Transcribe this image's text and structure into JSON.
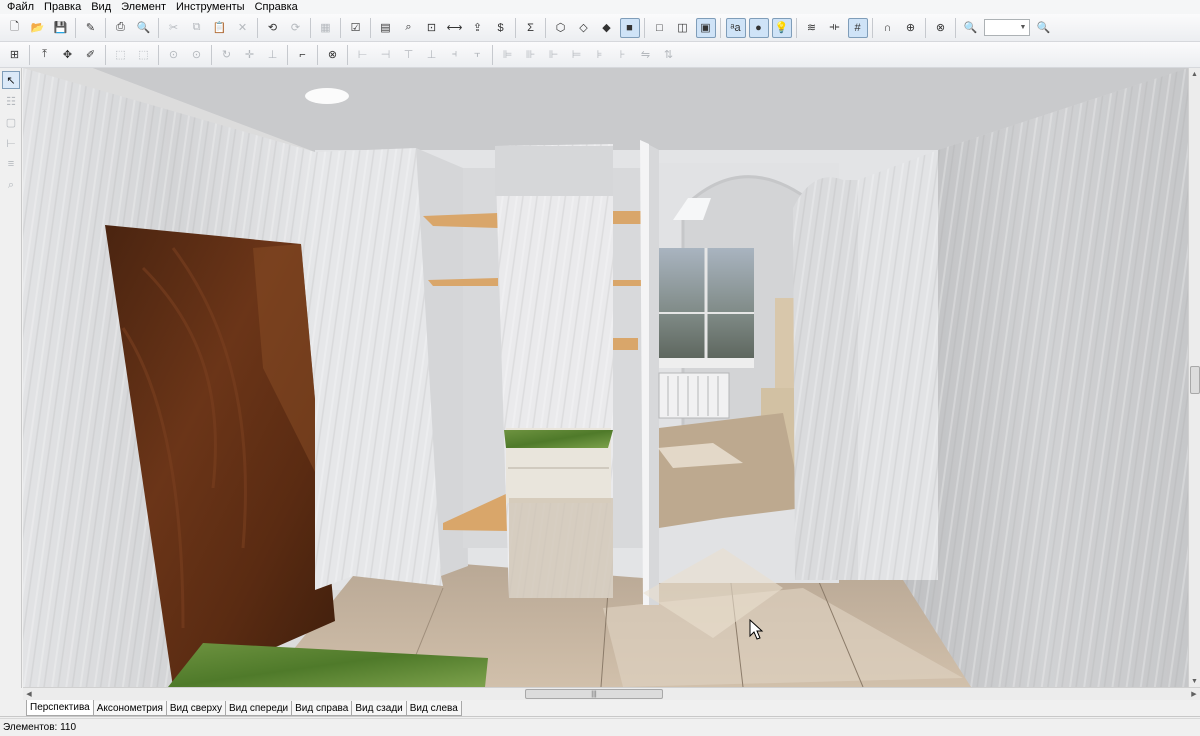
{
  "menu": [
    "Файл",
    "Правка",
    "Вид",
    "Элемент",
    "Инструменты",
    "Справка"
  ],
  "toolbar1": [
    {
      "name": "new-file-icon",
      "glyph": "🗋"
    },
    {
      "name": "open-folder-icon",
      "glyph": "📂"
    },
    {
      "name": "save-icon",
      "glyph": "💾"
    },
    {
      "sep": true
    },
    {
      "name": "properties-icon",
      "glyph": "✎"
    },
    {
      "sep": true
    },
    {
      "name": "print-icon",
      "glyph": "⎙"
    },
    {
      "name": "print-preview-icon",
      "glyph": "🔍"
    },
    {
      "sep": true
    },
    {
      "name": "cut-icon",
      "glyph": "✂",
      "dim": true
    },
    {
      "name": "copy-icon",
      "glyph": "⧉",
      "dim": true
    },
    {
      "name": "paste-icon",
      "glyph": "📋",
      "dim": true
    },
    {
      "name": "delete-icon",
      "glyph": "✕",
      "dim": true
    },
    {
      "sep": true
    },
    {
      "name": "undo-icon",
      "glyph": "⟲"
    },
    {
      "name": "redo-icon",
      "glyph": "⟳",
      "dim": true
    },
    {
      "sep": true
    },
    {
      "name": "group-icon",
      "glyph": "▦",
      "dim": true
    },
    {
      "sep": true
    },
    {
      "name": "checklist-icon",
      "glyph": "☑"
    },
    {
      "sep": true
    },
    {
      "name": "view-plan-icon",
      "glyph": "▤"
    },
    {
      "name": "view-zoom-icon",
      "glyph": "⌕"
    },
    {
      "name": "view-fit-icon",
      "glyph": "⊡"
    },
    {
      "name": "view-width-icon",
      "glyph": "⟷"
    },
    {
      "name": "export-icon",
      "glyph": "⇪"
    },
    {
      "name": "cost-icon",
      "glyph": "$"
    },
    {
      "sep": true
    },
    {
      "name": "sum-icon",
      "glyph": "Σ"
    },
    {
      "sep": true
    },
    {
      "name": "wireframe-cube-icon",
      "glyph": "⬡"
    },
    {
      "name": "outline-cube-icon",
      "glyph": "◇"
    },
    {
      "name": "shaded-cube-icon",
      "glyph": "◆"
    },
    {
      "name": "textured-cube-icon",
      "glyph": "■",
      "active": true
    },
    {
      "sep": true
    },
    {
      "name": "box-front-icon",
      "glyph": "□"
    },
    {
      "name": "box-side-icon",
      "glyph": "◫"
    },
    {
      "name": "box-filled-icon",
      "glyph": "▣",
      "active": true
    },
    {
      "sep": true
    },
    {
      "name": "antialias-icon",
      "glyph": "ᵃa",
      "active": true
    },
    {
      "name": "shadow-sphere-icon",
      "glyph": "●",
      "active": true
    },
    {
      "name": "light-bulb-icon",
      "glyph": "💡",
      "active": true
    },
    {
      "sep": true
    },
    {
      "name": "snap-icon",
      "glyph": "≋"
    },
    {
      "name": "dimension-icon",
      "glyph": "⟛"
    },
    {
      "name": "grid-icon",
      "glyph": "#",
      "active": true
    },
    {
      "sep": true
    },
    {
      "name": "magnet-icon",
      "glyph": "∩"
    },
    {
      "name": "target-icon",
      "glyph": "⊕"
    },
    {
      "sep": true
    },
    {
      "name": "lifebuoy-icon",
      "glyph": "⊗"
    },
    {
      "sep": true
    },
    {
      "name": "zoom-out-icon",
      "glyph": "🔍",
      "dim": true
    },
    {
      "zoom": true
    },
    {
      "name": "zoom-in-icon",
      "glyph": "🔍",
      "dim": true
    }
  ],
  "toolbar2": [
    {
      "name": "select-grid-icon",
      "glyph": "⊞"
    },
    {
      "sep": true
    },
    {
      "name": "move-up-icon",
      "glyph": "⤒"
    },
    {
      "name": "move-icon",
      "glyph": "✥"
    },
    {
      "name": "edit-point-icon",
      "glyph": "✐"
    },
    {
      "sep": true
    },
    {
      "name": "frame-select-icon",
      "glyph": "⬚",
      "dim": true
    },
    {
      "name": "frame-move-icon",
      "glyph": "⬚",
      "dim": true
    },
    {
      "sep": true
    },
    {
      "name": "pivot-icon",
      "glyph": "⊙",
      "dim": true
    },
    {
      "name": "pivot-move-icon",
      "glyph": "⊙",
      "dim": true
    },
    {
      "sep": true
    },
    {
      "name": "rotate-icon",
      "glyph": "↻",
      "dim": true
    },
    {
      "name": "transform-icon",
      "glyph": "✛",
      "dim": true
    },
    {
      "name": "align-base-icon",
      "glyph": "⊥",
      "dim": true
    },
    {
      "sep": true
    },
    {
      "name": "paint-roller-icon",
      "glyph": "⌐"
    },
    {
      "sep": true
    },
    {
      "name": "target2-icon",
      "glyph": "⊗"
    },
    {
      "sep": true
    },
    {
      "name": "align-left-icon",
      "glyph": "⊢",
      "dim": true
    },
    {
      "name": "align-hcenter-icon",
      "glyph": "⊣",
      "dim": true
    },
    {
      "name": "align-top-icon",
      "glyph": "⊤",
      "dim": true
    },
    {
      "name": "align-vcenter-icon",
      "glyph": "⊥",
      "dim": true
    },
    {
      "name": "align-right-icon",
      "glyph": "⫞",
      "dim": true
    },
    {
      "name": "align-bottom-icon",
      "glyph": "⫟",
      "dim": true
    },
    {
      "sep": true
    },
    {
      "name": "distribute-left-icon",
      "glyph": "⊫",
      "dim": true
    },
    {
      "name": "distribute-center-icon",
      "glyph": "⊪",
      "dim": true
    },
    {
      "name": "distribute-right-icon",
      "glyph": "⊩",
      "dim": true
    },
    {
      "name": "distribute-top-icon",
      "glyph": "⊨",
      "dim": true
    },
    {
      "name": "distribute-middle-icon",
      "glyph": "⊧",
      "dim": true
    },
    {
      "name": "distribute-bottom-icon",
      "glyph": "⊦",
      "dim": true
    },
    {
      "name": "flip-h-icon",
      "glyph": "⇋",
      "dim": true
    },
    {
      "name": "flip-v-icon",
      "glyph": "⇅",
      "dim": true
    }
  ],
  "left_tools": [
    {
      "name": "pointer-tool-icon",
      "glyph": "↖",
      "active": true
    },
    {
      "name": "wall-tool-icon",
      "glyph": "☷"
    },
    {
      "name": "box-tool-icon",
      "glyph": "▢"
    },
    {
      "name": "ruler-tool-icon",
      "glyph": "⊢"
    },
    {
      "name": "text-tool-icon",
      "glyph": "≡"
    },
    {
      "name": "zoom-tool-icon",
      "glyph": "⌕"
    }
  ],
  "view_tabs": [
    "Перспектива",
    "Аксонометрия",
    "Вид сверху",
    "Вид спереди",
    "Вид справа",
    "Вид сзади",
    "Вид слева"
  ],
  "active_tab": 0,
  "status": {
    "elements_label": "Элементов: 110"
  }
}
